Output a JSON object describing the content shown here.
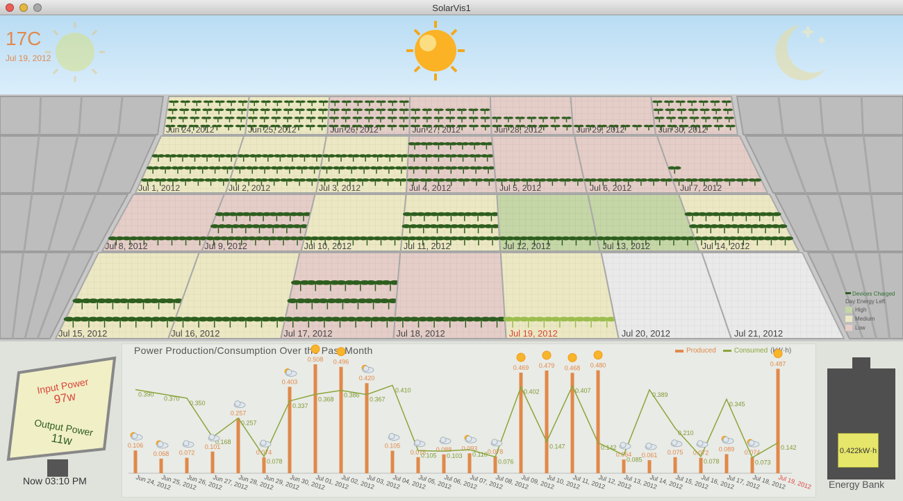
{
  "app": {
    "title": "SolarVis1"
  },
  "weather": {
    "temperature": "17C",
    "date": "Jul 19, 2012"
  },
  "calendar": {
    "rows": [
      [
        {
          "date": "Jun 24, 2012",
          "level": "medium",
          "plants": 28
        },
        {
          "date": "Jun 25, 2012",
          "level": "medium",
          "plants": 28
        },
        {
          "date": "Jun 26, 2012",
          "level": "low",
          "plants": 28
        },
        {
          "date": "Jun 27, 2012",
          "level": "low",
          "plants": 21
        },
        {
          "date": "Jun 28, 2012",
          "level": "low",
          "plants": 14
        },
        {
          "date": "Jun 29, 2012",
          "level": "low",
          "plants": 7
        },
        {
          "date": "Jun 30, 2012",
          "level": "low",
          "plants": 28
        }
      ],
      [
        {
          "date": "Jul 1, 2012",
          "level": "medium",
          "plants": 21
        },
        {
          "date": "Jul 2, 2012",
          "level": "medium",
          "plants": 21
        },
        {
          "date": "Jul 3, 2012",
          "level": "medium",
          "plants": 21
        },
        {
          "date": "Jul 4, 2012",
          "level": "low",
          "plants": 28
        },
        {
          "date": "Jul 5, 2012",
          "level": "low",
          "plants": 7
        },
        {
          "date": "Jul 6, 2012",
          "level": "low",
          "plants": 7
        },
        {
          "date": "Jul 7, 2012",
          "level": "low",
          "plants": 8
        }
      ],
      [
        {
          "date": "Jul 8, 2012",
          "level": "low",
          "plants": 7
        },
        {
          "date": "Jul 9, 2012",
          "level": "low",
          "plants": 21
        },
        {
          "date": "Jul 10, 2012",
          "level": "medium",
          "plants": 7
        },
        {
          "date": "Jul 11, 2012",
          "level": "medium",
          "plants": 21
        },
        {
          "date": "Jul 12, 2012",
          "level": "high",
          "plants": 7
        },
        {
          "date": "Jul 13, 2012",
          "level": "high",
          "plants": 7
        },
        {
          "date": "Jul 14, 2012",
          "level": "medium",
          "plants": 21
        }
      ],
      [
        {
          "date": "Jul 15, 2012",
          "level": "medium",
          "plants": 14
        },
        {
          "date": "Jul 16, 2012",
          "level": "medium",
          "plants": 7
        },
        {
          "date": "Jul 17, 2012",
          "level": "low",
          "plants": 21
        },
        {
          "date": "Jul 18, 2012",
          "level": "low",
          "plants": 7
        },
        {
          "date": "Jul 19, 2012",
          "level": "medium",
          "plants": 7,
          "today": true
        },
        {
          "date": "Jul 20, 2012",
          "level": "none",
          "plants": 0
        },
        {
          "date": "Jul 21, 2012",
          "level": "none",
          "plants": 0
        }
      ]
    ]
  },
  "legend": {
    "devices_charged": "Devices Charged",
    "day_energy_left": "Day Energy Left",
    "high": "High",
    "medium": "Medium",
    "low": "Low"
  },
  "colors": {
    "high": "#c5d6a7",
    "medium": "#ece8c3",
    "low": "#e5cdc8",
    "none": "#eaeaea",
    "produced": "#e0894a",
    "consumed": "#8aa53a",
    "plant": "#2e5e1f",
    "plant_today": "#9bbd4e",
    "today_text": "#d9453b"
  },
  "meter": {
    "input_label": "Input Power",
    "input_value": "97w",
    "output_label": "Output Power",
    "output_value": "11w"
  },
  "clock": {
    "now": "Now 03:10 PM"
  },
  "energy_bank": {
    "label": "Energy Bank",
    "value": "0.422kW·h",
    "level": 0.27
  },
  "chart_data": {
    "type": "bar",
    "title": "Power Production/Consumption Over the Past Month",
    "legend": {
      "produced": "Produced",
      "consumed": "Consumed",
      "unit": "(kW·h)"
    },
    "categories": [
      "Jun 24, 2012",
      "Jun 25, 2012",
      "Jun 26, 2012",
      "Jun 27, 2012",
      "Jun 28, 2012",
      "Jun 29, 2012",
      "Jun 30, 2012",
      "Jul 01, 2012",
      "Jul 02, 2012",
      "Jul 03, 2012",
      "Jul 04, 2012",
      "Jul 05, 2012",
      "Jul 06, 2012",
      "Jul 07, 2012",
      "Jul 08, 2012",
      "Jul 09, 2012",
      "Jul 10, 2012",
      "Jul 11, 2012",
      "Jul 12, 2012",
      "Jul 13, 2012",
      "Jul 14, 2012",
      "Jul 15, 2012",
      "Jul 16, 2012",
      "Jul 17, 2012",
      "Jul 18, 2012",
      "Jul 19, 2012"
    ],
    "series": [
      {
        "name": "Produced",
        "type": "bar",
        "values": [
          0.106,
          0.068,
          0.072,
          0.101,
          0.257,
          0.074,
          0.403,
          0.508,
          0.496,
          0.42,
          0.105,
          0.075,
          0.088,
          0.093,
          0.078,
          0.469,
          0.479,
          0.468,
          0.48,
          0.064,
          0.061,
          0.075,
          0.072,
          0.089,
          0.074,
          0.487
        ],
        "labels": [
          "0.106",
          "0.068",
          "0.072",
          "0.101",
          "0.257",
          "0.074",
          "0.403",
          "0.508",
          "0.496",
          "0.420",
          "0.105",
          "0.075",
          "0.088",
          "0.093",
          "0.078",
          "0.469",
          "0.479",
          "0.468",
          "0.480",
          "0.064",
          "0.061",
          "0.075",
          "0.072",
          "0.089",
          "0.074",
          "0.487"
        ]
      },
      {
        "name": "Consumed",
        "type": "line",
        "values": [
          0.39,
          0.37,
          0.35,
          0.168,
          0.257,
          0.078,
          0.337,
          0.368,
          0.386,
          0.367,
          0.41,
          0.105,
          0.103,
          0.11,
          0.076,
          0.402,
          0.147,
          0.407,
          0.142,
          0.085,
          0.389,
          0.21,
          0.078,
          0.345,
          0.073,
          0.142
        ],
        "labels": [
          "0.390",
          "0.370",
          "0.350",
          "0.168",
          "0.257",
          "0.078",
          "0.337",
          "0.368",
          "0.386",
          "0.367",
          "0.410",
          "0.105",
          "0.103",
          "0.110",
          "0.076",
          "0.402",
          "0.147",
          "0.407",
          "0.142",
          "0.085",
          "0.389",
          "0.210",
          "0.078",
          "0.345",
          "0.073",
          "0.142"
        ]
      }
    ],
    "weather": [
      "partly-sunny",
      "partly-sunny",
      "cloudy",
      "cloudy",
      "cloudy",
      "cloudy",
      "partly-sunny",
      "sunny",
      "sunny",
      "partly-sunny",
      "cloudy",
      "cloudy",
      "cloudy",
      "partly-sunny",
      "cloudy",
      "sunny",
      "sunny",
      "sunny",
      "sunny",
      "cloudy",
      "cloudy",
      "cloudy",
      "cloudy",
      "partly-sunny",
      "partly-sunny",
      "sunny"
    ],
    "ylim": [
      0,
      0.55
    ],
    "grid": false,
    "legend_position": "top-right"
  }
}
